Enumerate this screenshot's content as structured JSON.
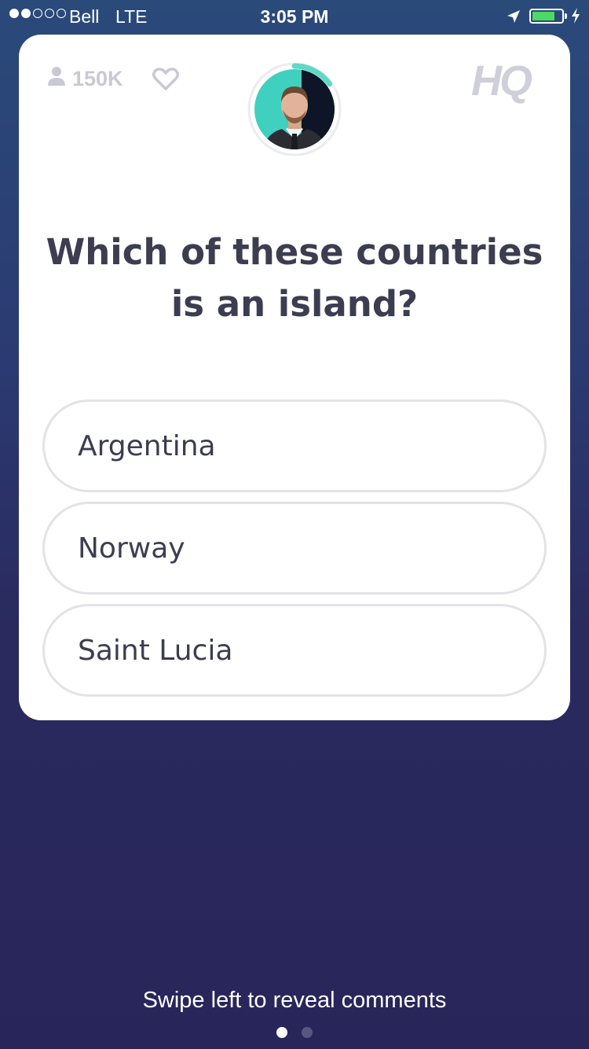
{
  "status_bar": {
    "carrier": "Bell",
    "network": "LTE",
    "time": "3:05 PM",
    "signal_strength": 2,
    "signal_total": 5,
    "battery_level": 0.78
  },
  "header": {
    "viewer_count": "150K",
    "logo": "HQ",
    "icons": [
      "person-icon",
      "heart-icon",
      "host-avatar"
    ]
  },
  "question": {
    "text": "Which of these countries is an island?",
    "timer_progress": 0.15
  },
  "answers": [
    {
      "label": "Argentina"
    },
    {
      "label": "Norway"
    },
    {
      "label": "Saint Lucia"
    }
  ],
  "footer": {
    "hint": "Swipe left to reveal comments",
    "page_count": 2,
    "active_page": 0
  },
  "colors": {
    "accent_timer": "#5fd8c8",
    "battery": "#4cd964",
    "card_text": "#3c3d50",
    "muted": "#c9c9d3"
  }
}
